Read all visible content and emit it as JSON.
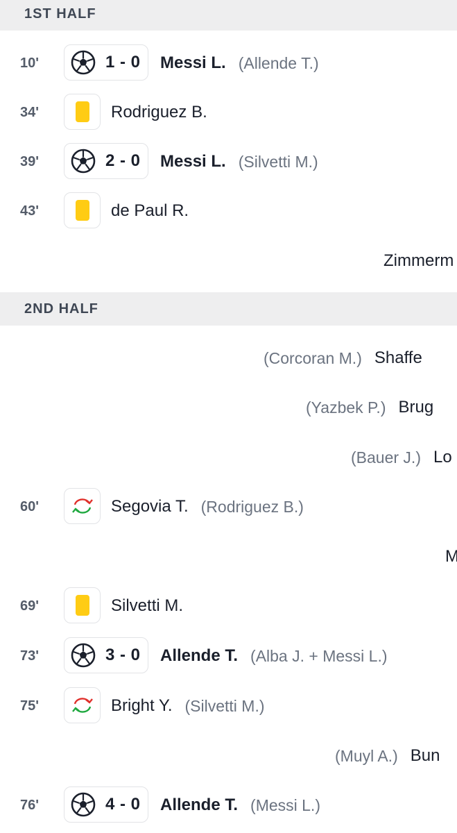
{
  "first_half": {
    "header": "1ST HALF",
    "events": [
      {
        "minute": "10'",
        "score": "1 - 0",
        "player": "Messi L.",
        "assist": "(Allende T.)"
      },
      {
        "minute": "34'",
        "player": "Rodriguez B."
      },
      {
        "minute": "39'",
        "score": "2 - 0",
        "player": "Messi L.",
        "assist": "(Silvetti M.)"
      },
      {
        "minute": "43'",
        "player": "de Paul R."
      }
    ],
    "away_events": [
      {
        "player": "Zimmerm"
      }
    ]
  },
  "second_half": {
    "header": "2ND HALF",
    "away_events": [
      {
        "assist": "(Corcoran M.)",
        "player": "Shaffe"
      },
      {
        "assist": "(Yazbek P.)",
        "player": "Brug"
      },
      {
        "assist": "(Bauer J.)",
        "player": "Lo"
      },
      {
        "player": "M"
      },
      {
        "assist": "(Muyl A.)",
        "player": "Bun"
      }
    ],
    "events": [
      {
        "minute": "60'",
        "player": "Segovia T.",
        "assist": "(Rodriguez B.)"
      },
      {
        "minute": "69'",
        "player": "Silvetti M."
      },
      {
        "minute": "73'",
        "score": "3 - 0",
        "player": "Allende T.",
        "assist": "(Alba J. + Messi L.)"
      },
      {
        "minute": "75'",
        "player": "Bright Y.",
        "assist": "(Silvetti M.)"
      },
      {
        "minute": "76'",
        "score": "4 - 0",
        "player": "Allende T.",
        "assist": "(Messi L.)"
      }
    ]
  },
  "colors": {
    "yellow_card": "#ffcc14",
    "sub_in": "#1fa83f",
    "sub_out": "#e0302b",
    "header_bg": "#eeeeef"
  },
  "icons": {
    "goal": "soccer-ball-icon",
    "yellow": "yellow-card-icon",
    "substitution": "substitution-icon"
  }
}
